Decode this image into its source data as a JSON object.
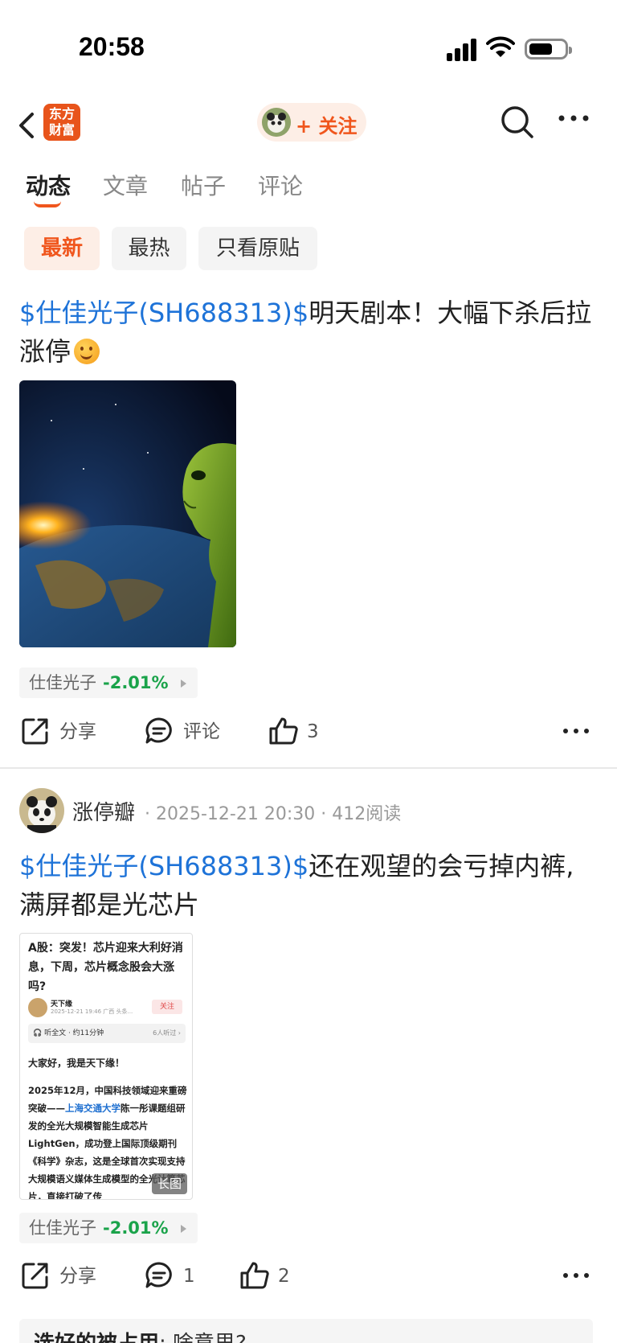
{
  "status_bar": {
    "time": "20:58"
  },
  "header": {
    "logo_line1": "东方",
    "logo_line2": "财富",
    "follow_label": "+ 关注"
  },
  "tabs": [
    {
      "label": "动态",
      "active": true
    },
    {
      "label": "文章",
      "active": false
    },
    {
      "label": "帖子",
      "active": false
    },
    {
      "label": "评论",
      "active": false
    }
  ],
  "filters": [
    {
      "label": "最新",
      "active": true
    },
    {
      "label": "最热",
      "active": false
    },
    {
      "label": "只看原贴",
      "active": false
    }
  ],
  "posts": [
    {
      "stock_tag": "$仕佳光子(SH688313)$",
      "text_line1": "明天剧本！大幅下杀后拉",
      "text_line2": "涨停",
      "quote": {
        "name": "仕佳光子",
        "change": "-2.01%"
      },
      "actions": {
        "share": "分享",
        "comment": "评论",
        "like": "3"
      }
    },
    {
      "author": "涨停瓣",
      "datetime": "2025-12-21 20:30",
      "reads": "412阅读",
      "stock_tag": "$仕佳光子(SH688313)$",
      "text_line1": "还在观望的会亏掉内裤,",
      "text_line2": "满屏都是光芯片",
      "article_preview": {
        "title": "A股：突发！芯片迎来大利好消息，下周，芯片概念股会大涨吗?",
        "author": "天下缘",
        "author_sub": "2025-12-21 19:46 广西 头条...",
        "follow": "关注",
        "listen": "听全文 · 约11分钟",
        "listen_count": "6人听过 ›",
        "greeting": "大家好，我是天下缘！",
        "body_before": "2025年12月，中国科技领域迎来重磅突破——",
        "body_highlight": "上海交通大学",
        "body_after": "陈一彤课题组研发的全光大规模智能生成芯片LightGen，成功登上国际顶级期刊《科学》杂志，这是全球首次实现支持大规模语义媒体生成模型的全光计算芯片，直接打破了传",
        "badge": "长图"
      },
      "quote": {
        "name": "仕佳光子",
        "change": "-2.01%"
      },
      "actions": {
        "share": "分享",
        "comment": "1",
        "like": "2"
      },
      "top_comment": {
        "user": "选好的被占用",
        "sep": ":",
        "text": "啥意思?"
      }
    }
  ],
  "colors": {
    "accent": "#f0561d",
    "link": "#1e73d8",
    "down": "#1aa34a"
  }
}
